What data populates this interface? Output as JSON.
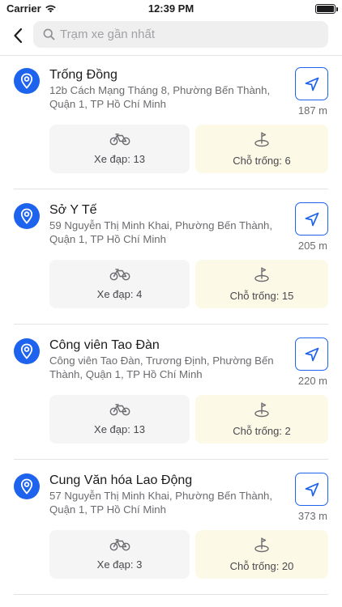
{
  "status_bar": {
    "carrier": "Carrier",
    "time": "12:39 PM"
  },
  "nav": {
    "search_placeholder": "Trạm xe gần nhất"
  },
  "colors": {
    "accent": "#1e63ee",
    "bikes_box": "#f5f5f6",
    "slots_box": "#fcf9e6"
  },
  "stations": [
    {
      "name": "Trống Đồng",
      "address": "12b Cách Mạng Tháng 8, Phường Bến Thành, Quận 1, TP Hồ Chí Minh",
      "distance": "187 m",
      "bikes_label": "Xe đạp: 13",
      "slots_label": "Chỗ trống: 6"
    },
    {
      "name": "Sở Y Tế",
      "address": "59 Nguyễn Thị Minh Khai, Phường Bến Thành, Quận 1, TP Hồ Chí Minh",
      "distance": "205 m",
      "bikes_label": "Xe đạp: 4",
      "slots_label": "Chỗ trống: 15"
    },
    {
      "name": "Công viên Tao Đàn",
      "address": "Công viên Tao Đàn, Trương Định, Phường Bến Thành, Quận 1, TP Hồ Chí Minh",
      "distance": "220 m",
      "bikes_label": "Xe đạp: 13",
      "slots_label": "Chỗ trống: 2"
    },
    {
      "name": "Cung Văn hóa Lao Động",
      "address": "57 Nguyễn Thị Minh Khai, Phường Bến Thành, Quận 1, TP Hồ Chí Minh",
      "distance": "373 m",
      "bikes_label": "Xe đạp: 3",
      "slots_label": "Chỗ trống: 20"
    }
  ]
}
